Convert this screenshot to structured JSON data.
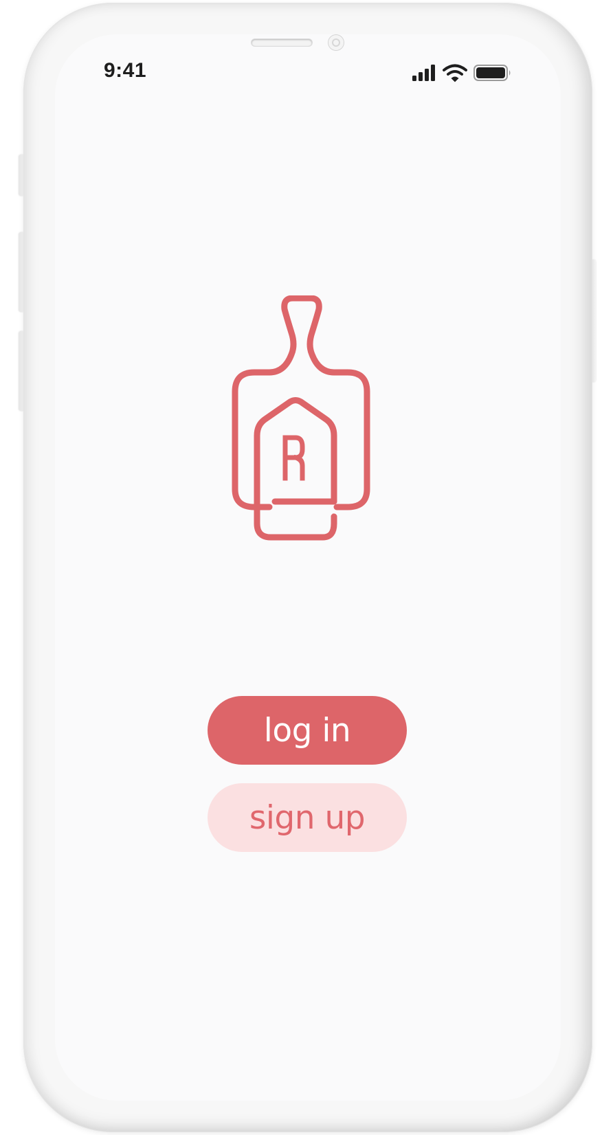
{
  "status_bar": {
    "time": "9:41",
    "icons": [
      "signal-icon",
      "wifi-icon",
      "battery-icon"
    ]
  },
  "logo": {
    "icon": "cutting-board-logo-icon",
    "monogram": "R",
    "color": "#dd6569"
  },
  "actions": {
    "login_label": "log in",
    "signup_label": "sign up"
  },
  "colors": {
    "primary": "#dd6569",
    "secondary_bg": "#fbe0e1",
    "secondary_text": "#e0676d",
    "screen_bg": "#fafafb"
  }
}
